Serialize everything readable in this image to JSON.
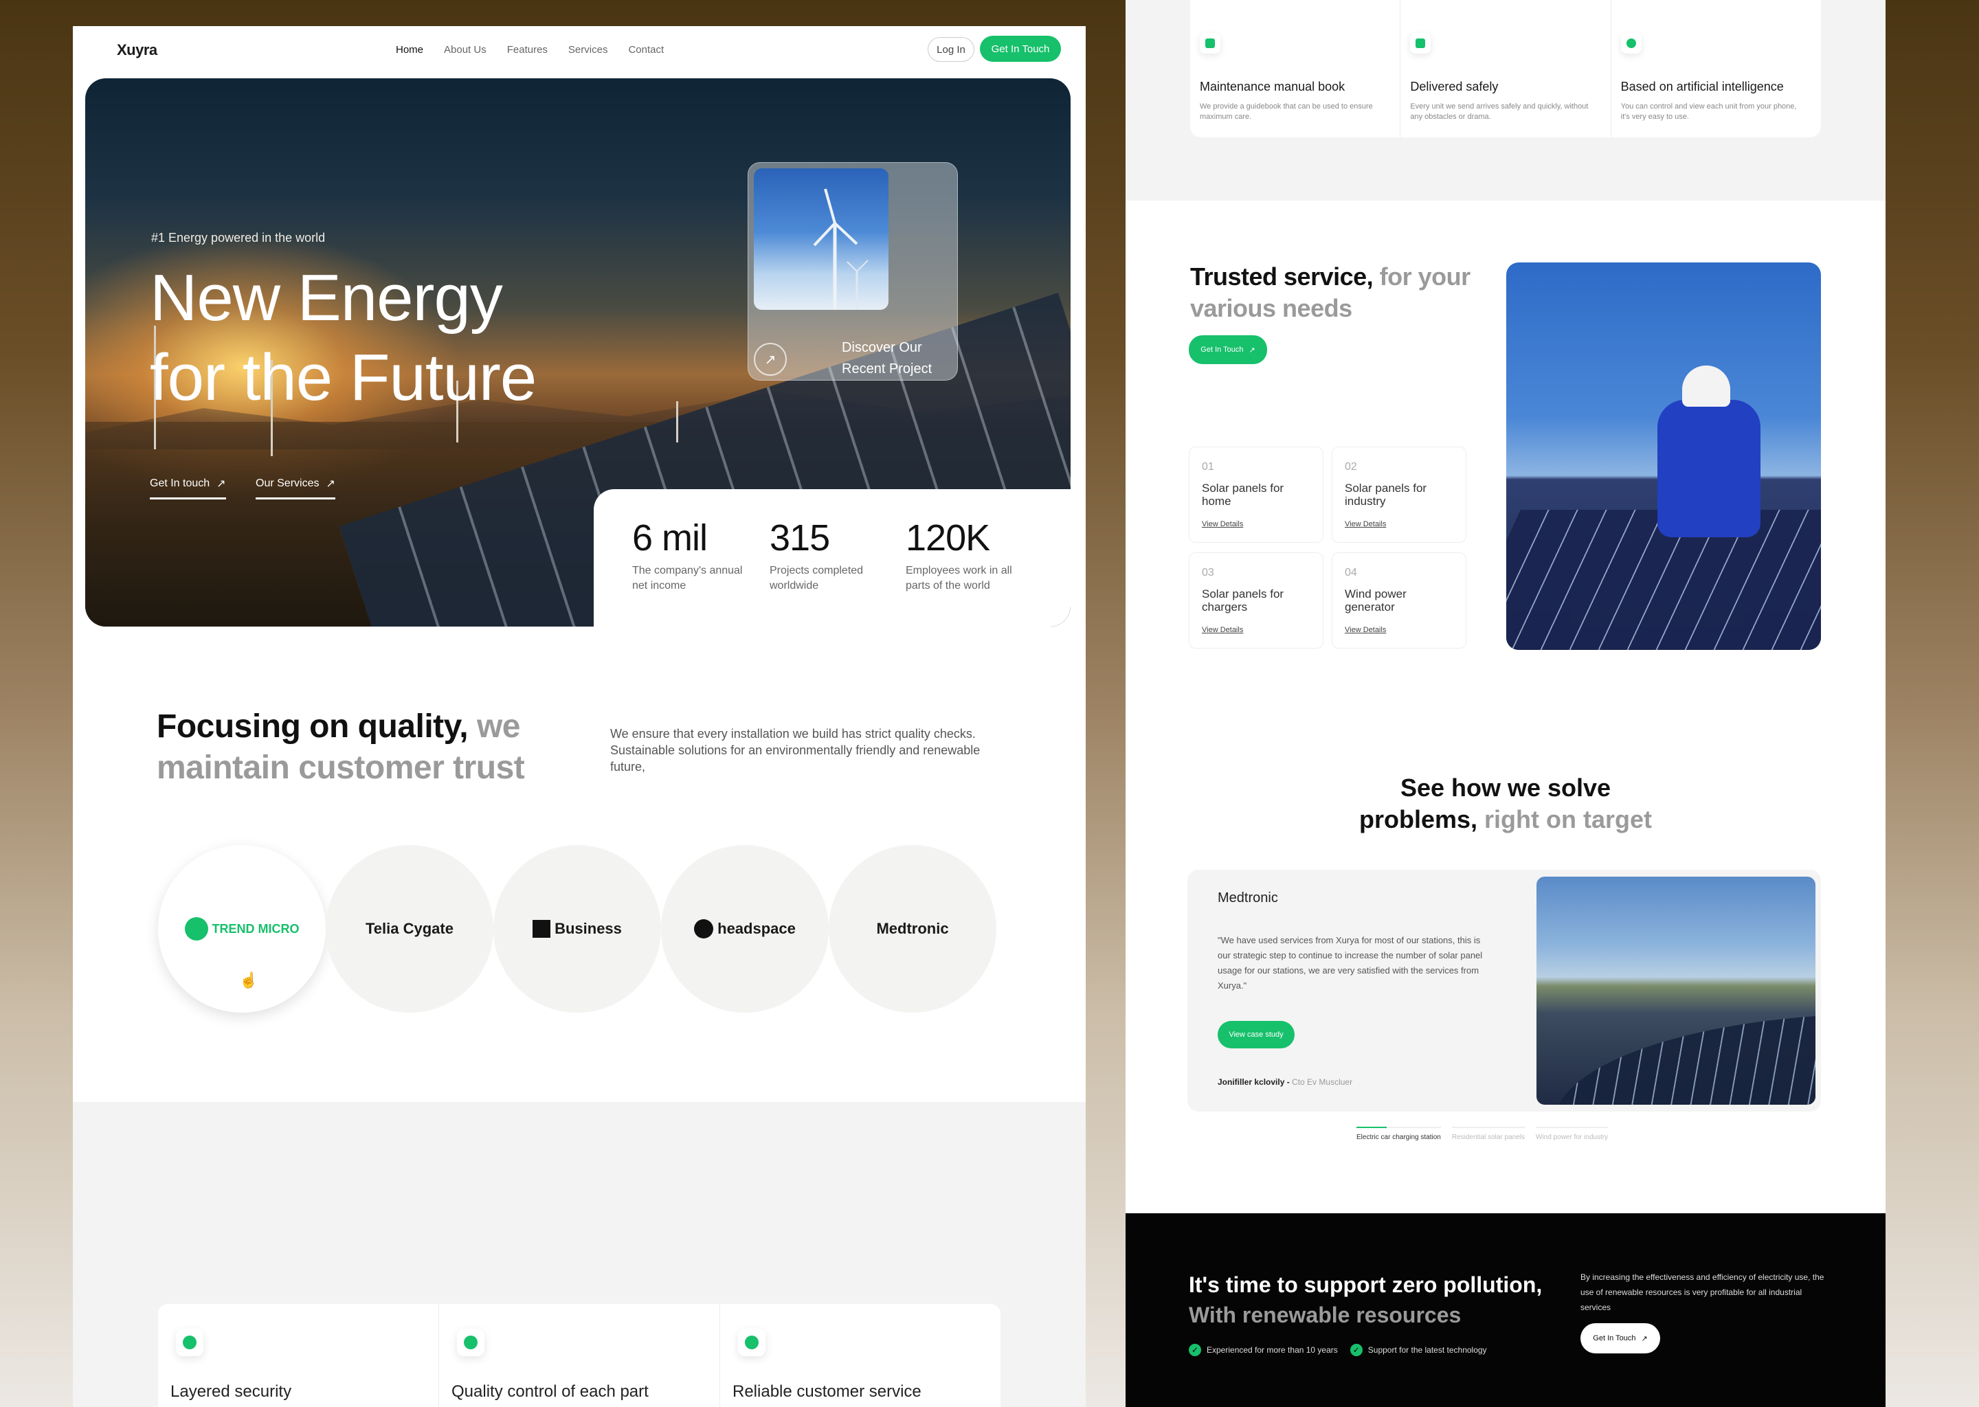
{
  "nav": {
    "logo": "Xuyra",
    "items": [
      "Home",
      "About Us",
      "Features",
      "Services",
      "Contact"
    ],
    "login": "Log In",
    "cta": "Get In Touch"
  },
  "hero": {
    "tag": "#1 Energy powered in the world",
    "title_line1": "New Energy",
    "title_line2": "for the Future",
    "link1": "Get In touch",
    "link2": "Our Services",
    "project_line1": "Discover Our",
    "project_line2": "Recent Project",
    "stats": [
      {
        "value": "6 mil",
        "label": "The company's annual net income"
      },
      {
        "value": "315",
        "label": "Projects completed worldwide"
      },
      {
        "value": "120K",
        "label": "Employees work in all parts of the world"
      }
    ]
  },
  "quality": {
    "title_main": "Focusing on quality,",
    "title_muted": "we maintain customer trust",
    "text": "We ensure that every installation we build has strict quality checks. Sustainable solutions for an environmentally friendly and renewable future,",
    "logos": [
      "TREND MICRO",
      "Telia Cygate",
      "Business",
      "headspace",
      "Medtronic"
    ]
  },
  "features_left": [
    "Layered security",
    "Quality control of each part",
    "Reliable customer service"
  ],
  "features_right": [
    {
      "title": "Maintenance manual book",
      "desc": "We provide a guidebook that can be used to ensure maximum care."
    },
    {
      "title": "Delivered safely",
      "desc": "Every unit we send arrives safely and quickly, without any obstacles or drama."
    },
    {
      "title": "Based on artificial intelligence",
      "desc": "You can control and view each unit from your phone, it's very easy to use."
    }
  ],
  "trusted": {
    "title_main": "Trusted service,",
    "title_muted": "for your various needs",
    "cta": "Get In Touch",
    "services": [
      {
        "num": "01",
        "title": "Solar panels for home",
        "link": "View Details"
      },
      {
        "num": "02",
        "title": "Solar panels for industry",
        "link": "View Details"
      },
      {
        "num": "03",
        "title": "Solar panels for chargers",
        "link": "View Details"
      },
      {
        "num": "04",
        "title": "Wind power generator",
        "link": "View Details"
      }
    ]
  },
  "solve": {
    "title_line1": "See how we solve",
    "title_main": "problems,",
    "title_muted": "right on target",
    "company": "Medtronic",
    "quote": "\"We have used services from Xurya for most of our stations, this is our strategic step to continue to increase the number of solar panel usage for our stations, we are very satisfied with the services from Xurya.\"",
    "button": "View case study",
    "author_name": "Jonifiller kclovily -",
    "author_role": "Cto  Ev Muscluer",
    "tabs": [
      "Electric car charging station",
      "Residential solar panels",
      "Wind power for industry"
    ]
  },
  "cta_band": {
    "title": "It's time to support zero pollution,",
    "subtitle": "With renewable resources",
    "check1": "Experienced for more than 10 years",
    "check2": "Support for the latest technology",
    "text": "By increasing the effectiveness and efficiency of electricity use, the use of renewable resources is very profitable for all industrial services",
    "button": "Get In Touch"
  },
  "colors": {
    "accent": "#17c06b",
    "dark": "#050505"
  }
}
